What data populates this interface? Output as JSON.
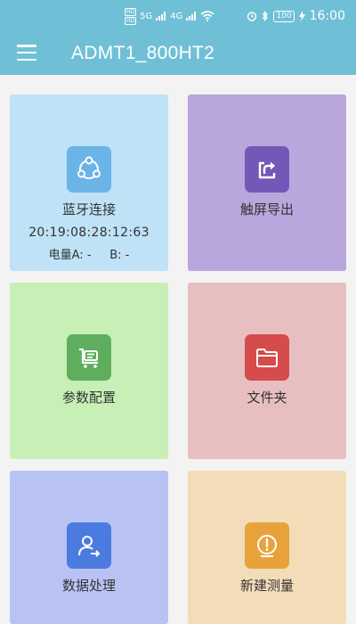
{
  "status_bar": {
    "network_1": "HD",
    "network_2": "HD",
    "signal_1": "5G",
    "signal_2": "4G",
    "battery": "100",
    "time": "16:00"
  },
  "app_bar": {
    "title": "ADMT1_800HT2",
    "menu_icon": "hamburger-menu-icon"
  },
  "tiles": [
    {
      "label": "蓝牙连接",
      "timestamp": "20:19:08:28:12:63",
      "battery_a_label": "电量A:",
      "battery_a_value": "-",
      "battery_b_label": "B:",
      "battery_b_value": "-",
      "color": "#bfe2f7",
      "icon_color": "#6ab4e8",
      "icon": "share-network-icon"
    },
    {
      "label": "触屏导出",
      "color": "#b9a6dd",
      "icon_color": "#7458b8",
      "icon": "export-icon"
    },
    {
      "label": "参数配置",
      "color": "#c8f0b6",
      "icon_color": "#5fae5e",
      "icon": "cart-list-icon"
    },
    {
      "label": "文件夹",
      "color": "#e7bfc0",
      "icon_color": "#d64b4b",
      "icon": "folder-icon"
    },
    {
      "label": "数据处理",
      "color": "#b9c3f3",
      "icon_color": "#4c7be0",
      "icon": "user-arrow-icon"
    },
    {
      "label": "新建测量",
      "color": "#f3dcb8",
      "icon_color": "#e8a23c",
      "icon": "gauge-icon"
    }
  ]
}
